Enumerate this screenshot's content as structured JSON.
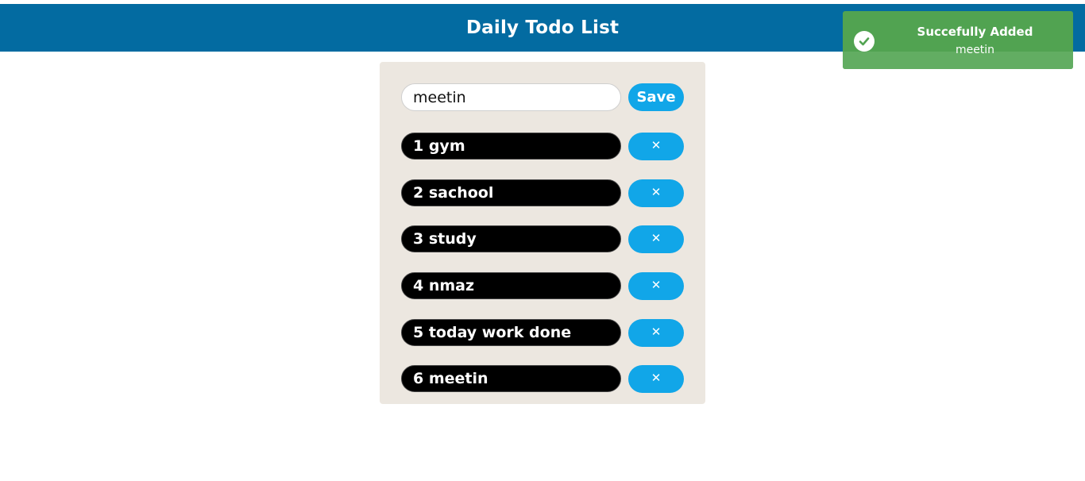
{
  "header": {
    "title": "Daily Todo List"
  },
  "form": {
    "input_value": "meetin",
    "save_label": "Save"
  },
  "todos": [
    {
      "text": "1 gym",
      "delete_label": "✕"
    },
    {
      "text": "2 sachool",
      "delete_label": "✕"
    },
    {
      "text": "3 study",
      "delete_label": "✕"
    },
    {
      "text": "4 nmaz",
      "delete_label": "✕"
    },
    {
      "text": "5 today work done",
      "delete_label": "✕"
    },
    {
      "text": "6 meetin",
      "delete_label": "✕"
    }
  ],
  "toast": {
    "title": "Succefully Added",
    "message": "meetin",
    "icon": "check-circle-icon",
    "color": "#51a351"
  },
  "colors": {
    "header": "#036ba1",
    "button": "#11a6e8",
    "card": "#ece7e0",
    "todo_bg": "#000000"
  }
}
